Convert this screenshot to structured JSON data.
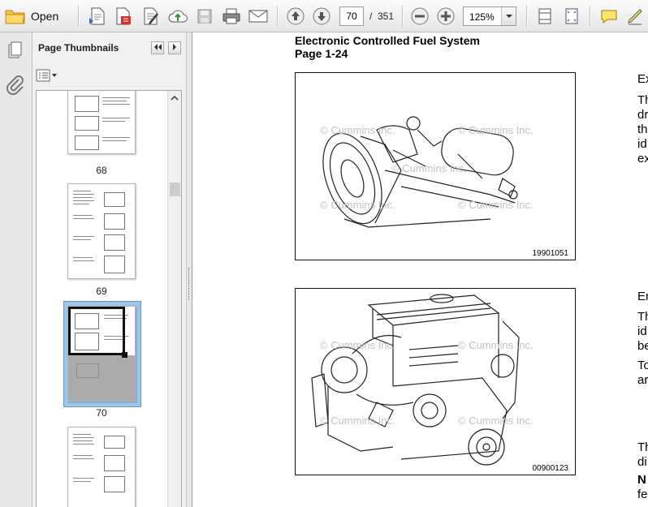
{
  "toolbar": {
    "open_label": "Open",
    "current_page": "70",
    "page_separator": "/",
    "page_total": "351",
    "zoom": "125%"
  },
  "icons": [
    "folder-icon",
    "create-pdf-icon",
    "convert-icon",
    "edit-icon",
    "upload-icon",
    "save-icon",
    "print-icon",
    "email-icon",
    "previous-page-icon",
    "next-page-icon",
    "zoom-out-icon",
    "zoom-in-icon",
    "zoom-dropdown-icon",
    "fit-width-icon",
    "fit-page-icon",
    "comment-icon",
    "sign-icon",
    "pages-icon",
    "attachment-icon",
    "options-icon",
    "collapse-icon",
    "expand-icon",
    "scroll-up-icon"
  ],
  "thumbnails_panel": {
    "title": "Page Thumbnails",
    "pages": [
      {
        "label": "68"
      },
      {
        "label": "69"
      },
      {
        "label": "70",
        "selected": true
      },
      {
        "label": ""
      }
    ]
  },
  "document": {
    "title": "Electronic Controlled Fuel System",
    "subtitle": "Page 1-24",
    "figures": [
      {
        "code": "19901051"
      },
      {
        "code": "00900123"
      }
    ],
    "watermark": "© Cummins Inc.",
    "side_column": {
      "block1_heading": "Ex",
      "block1_lines": [
        "Th",
        "dr",
        "th",
        "id",
        "ex"
      ],
      "block2_heading": "En",
      "block2_lines": [
        "Th",
        "id",
        "be"
      ],
      "block2b_lines": [
        "To",
        "ar"
      ],
      "block3_lines": [
        "Th",
        "di"
      ],
      "block4_lines": [
        "N",
        "fe"
      ]
    }
  }
}
